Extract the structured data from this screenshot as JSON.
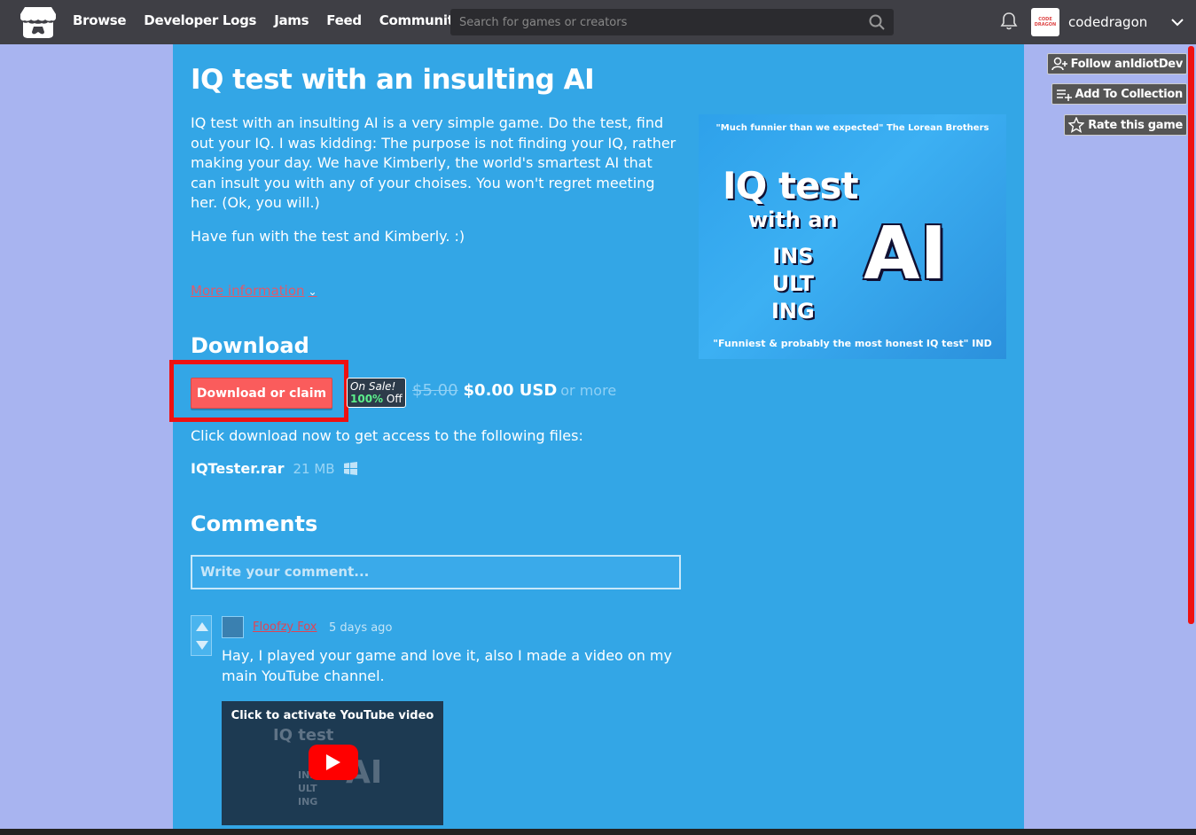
{
  "header": {
    "nav": [
      "Browse",
      "Developer Logs",
      "Jams",
      "Feed",
      "Community"
    ],
    "search_placeholder": "Search for games or creators",
    "username": "codedragon",
    "avatar_text": "CODE DRAGON"
  },
  "game": {
    "title": "IQ test with an insulting AI",
    "description": [
      "IQ test with an insulting AI is a very simple game. Do the test, find out your IQ. I was kidding: The purpose is not finding your IQ, rather making your day. We have Kimberly, the world's smartest AI that can insult you with any of your choises. You won't regret meeting her. (Ok, you will.)",
      "Have fun with the test and Kimberly. :)"
    ],
    "more_info": "More information",
    "cover": {
      "quote_top": "\"Much funnier than we expected\" The Lorean Brothers",
      "line1": "IQ test",
      "line2": "with an",
      "ins": [
        "INS",
        "ULT",
        "ING"
      ],
      "ai": "AI",
      "quote_bottom": "\"Funniest &  probably the most honest IQ test\" IND"
    }
  },
  "download": {
    "heading": "Download",
    "button": "Download or claim",
    "sale_label": "On Sale!",
    "sale_pct": "100%",
    "sale_off": "Off",
    "old_price": "$5.00",
    "new_price": "$0.00 USD",
    "or_more": "or more",
    "info": "Click download now to get access to the following files:",
    "file_name": "IQTester.rar",
    "file_size": "21 MB"
  },
  "comments": {
    "heading": "Comments",
    "placeholder": "Write your comment...",
    "items": [
      {
        "author": "Floofzy Fox",
        "date": "5 days ago",
        "body": "Hay, I played your game and love it, also I made a video on my main YouTube channel.",
        "video_label": "Click to activate YouTube video"
      }
    ]
  },
  "tools": {
    "follow": "Follow anIdiotDev",
    "collection": "Add To Collection",
    "rate": "Rate this game"
  },
  "colors": {
    "page_bg": "#a8b4f0",
    "content_bg": "#33a6e6",
    "header_bg": "#3f3f45",
    "button": "#fa5c5c",
    "highlight": "#ee1111"
  }
}
